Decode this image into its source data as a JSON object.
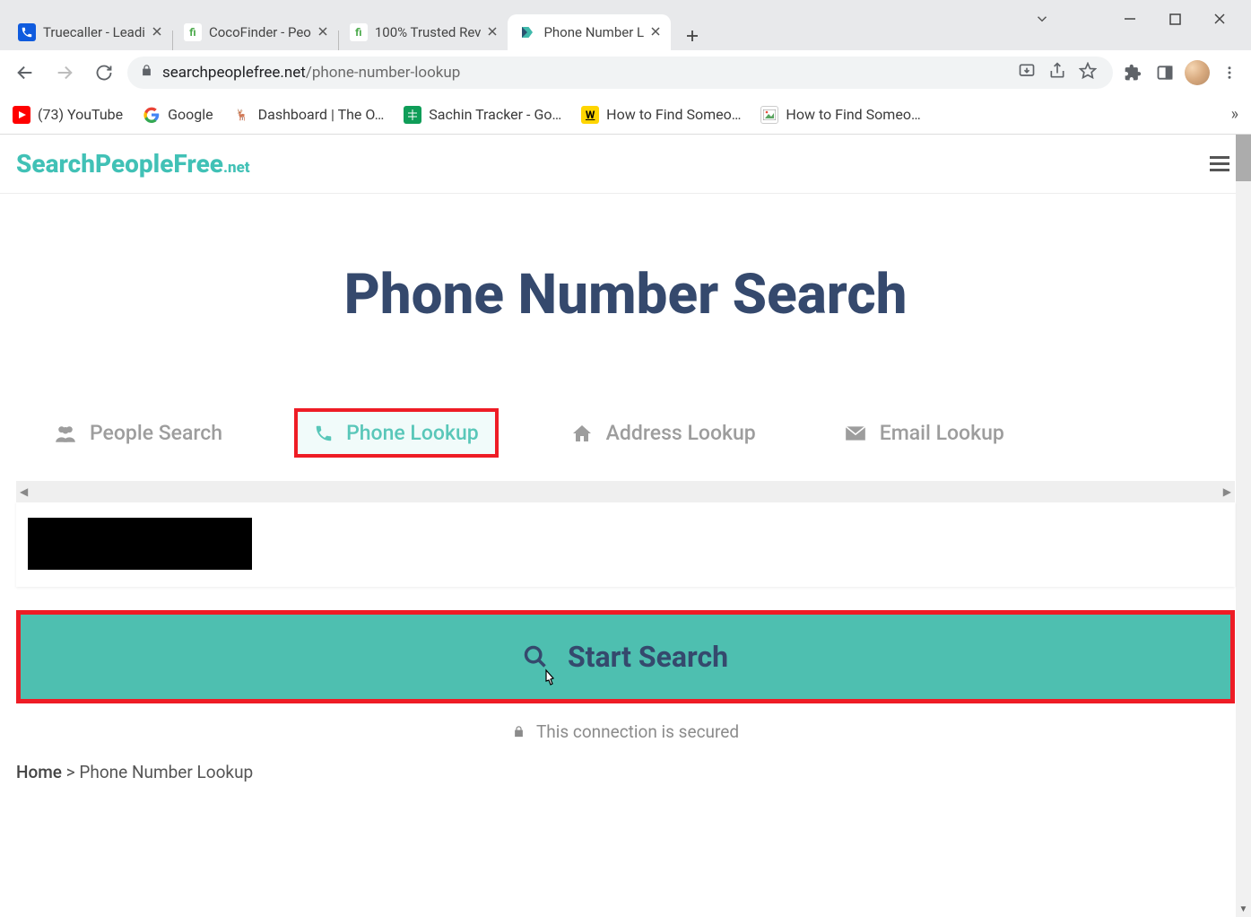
{
  "window": {
    "chevron": "⌄",
    "min": "—",
    "max": "☐",
    "close": "✕"
  },
  "tabs": [
    {
      "title": "Truecaller - Leadi",
      "favicon_bg": "#0f5bde",
      "favicon_fg": "#fff",
      "favicon_text": "📞",
      "active": false
    },
    {
      "title": "CocoFinder - Peo",
      "favicon_bg": "#fff",
      "favicon_fg": "#4aa94a",
      "favicon_text": "fi",
      "active": false
    },
    {
      "title": "100% Trusted Rev",
      "favicon_bg": "#fff",
      "favicon_fg": "#4aa94a",
      "favicon_text": "fi",
      "active": false
    },
    {
      "title": "Phone Number L",
      "favicon_bg": "#fff",
      "favicon_fg": "#41c1b6",
      "favicon_text": "S",
      "active": true
    }
  ],
  "new_tab": "+",
  "nav": {
    "back": "←",
    "forward": "→",
    "reload": "⟳"
  },
  "address": {
    "host": "searchpeoplefree.net",
    "path": "/phone-number-lookup"
  },
  "bookmarks": [
    {
      "label": "(73) YouTube",
      "bg": "#ff0000",
      "fg": "#fff",
      "txt": "▶"
    },
    {
      "label": "Google",
      "bg": "#fff",
      "fg": "#4285f4",
      "txt": "G"
    },
    {
      "label": "Dashboard | The O…",
      "bg": "#fff",
      "fg": "#d19a66",
      "txt": "🦌"
    },
    {
      "label": "Sachin Tracker - Go…",
      "bg": "#0f9d58",
      "fg": "#fff",
      "txt": "▦"
    },
    {
      "label": "How to Find Someo…",
      "bg": "#ffd500",
      "fg": "#000",
      "txt": "W"
    },
    {
      "label": "How to Find Someo…",
      "bg": "#fff",
      "fg": "#4a8",
      "txt": "🖼"
    }
  ],
  "bm_overflow": "»",
  "site": {
    "logo_main": "SearchPeopleFree",
    "logo_suffix": ".net",
    "title": "Phone Number Search",
    "tabs": [
      {
        "label": "People Search",
        "icon": "people",
        "active": false
      },
      {
        "label": "Phone Lookup",
        "icon": "phone",
        "active": true
      },
      {
        "label": "Address Lookup",
        "icon": "home",
        "active": false
      },
      {
        "label": "Email Lookup",
        "icon": "mail",
        "active": false
      }
    ],
    "search_value": "",
    "start_label": "Start Search",
    "secure_text": "This connection is secured",
    "breadcrumb_home": "Home",
    "breadcrumb_sep": ">",
    "breadcrumb_current": "Phone Number Lookup"
  }
}
